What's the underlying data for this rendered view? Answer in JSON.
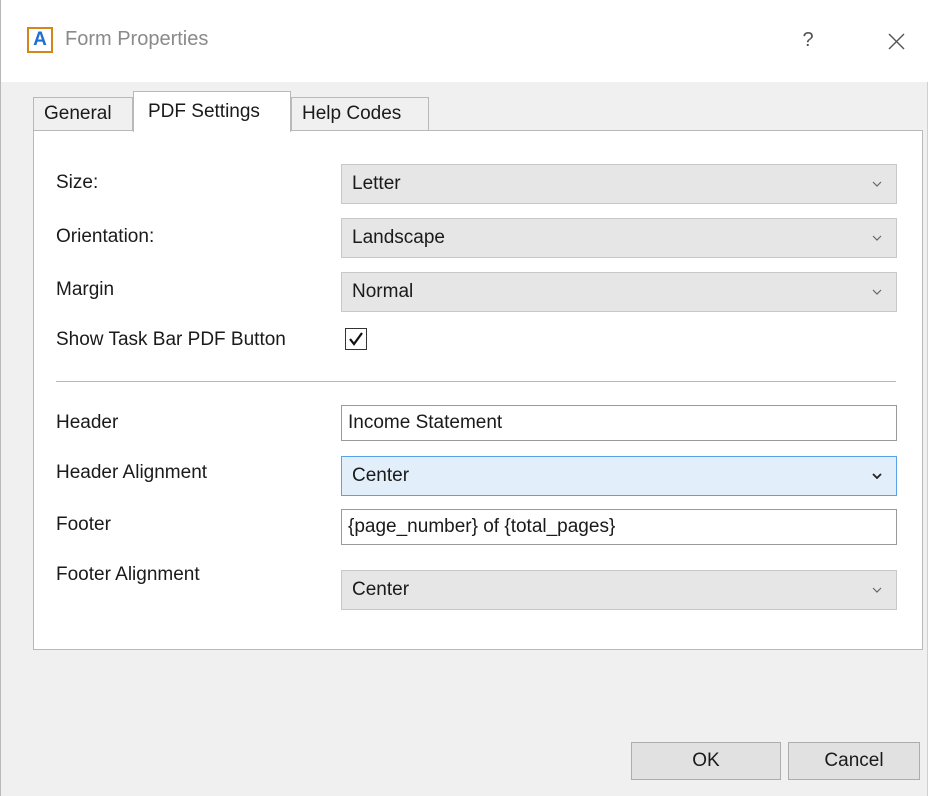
{
  "window": {
    "title": "Form Properties",
    "app_icon_letter": "A",
    "help_label": "?"
  },
  "tabs": [
    {
      "label": "General",
      "active": false
    },
    {
      "label": "PDF Settings",
      "active": true
    },
    {
      "label": "Help Codes",
      "active": false
    }
  ],
  "pdf_settings": {
    "size": {
      "label": "Size:",
      "value": "Letter"
    },
    "orientation": {
      "label": "Orientation:",
      "value": "Landscape"
    },
    "margin": {
      "label": "Margin",
      "value": "Normal"
    },
    "show_taskbar_pdf_button": {
      "label": "Show Task Bar PDF Button",
      "checked": true
    },
    "header": {
      "label": "Header",
      "value": "Income Statement"
    },
    "header_alignment": {
      "label": "Header Alignment",
      "value": "Center"
    },
    "footer": {
      "label": "Footer",
      "value": "{page_number} of {total_pages}"
    },
    "footer_alignment": {
      "label": "Footer Alignment",
      "value": "Center"
    }
  },
  "buttons": {
    "ok": "OK",
    "cancel": "Cancel"
  },
  "colors": {
    "focus_border": "#5aa2e8",
    "focus_fill": "#e3eefb",
    "app_icon_border": "#d4861a",
    "app_icon_letter": "#1f6fd1"
  }
}
